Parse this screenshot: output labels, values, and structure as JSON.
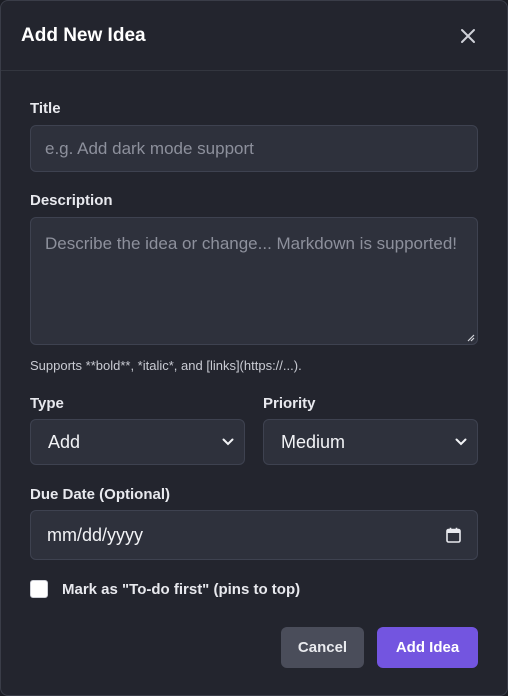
{
  "modal": {
    "title": "Add New Idea"
  },
  "title_field": {
    "label": "Title",
    "placeholder": "e.g. Add dark mode support"
  },
  "description_field": {
    "label": "Description",
    "placeholder": "Describe the idea or change... Markdown is supported!",
    "hint": "Supports **bold**, *italic*, and [links](https://...)."
  },
  "type_field": {
    "label": "Type",
    "selected": "Add"
  },
  "priority_field": {
    "label": "Priority",
    "selected": "Medium"
  },
  "due_date_field": {
    "label": "Due Date (Optional)",
    "value": "mm/dd/yyyy"
  },
  "todo_first": {
    "label": "Mark as \"To-do first\" (pins to top)",
    "checked": false
  },
  "actions": {
    "cancel_label": "Cancel",
    "submit_label": "Add Idea"
  },
  "colors": {
    "background": "#23252e",
    "input_bg": "#2e313c",
    "accent": "#7355e0",
    "cancel_bg": "#4a4d5a"
  },
  "icons": {
    "close": "close-icon",
    "chevron": "chevron-down-icon",
    "calendar": "calendar-icon"
  }
}
